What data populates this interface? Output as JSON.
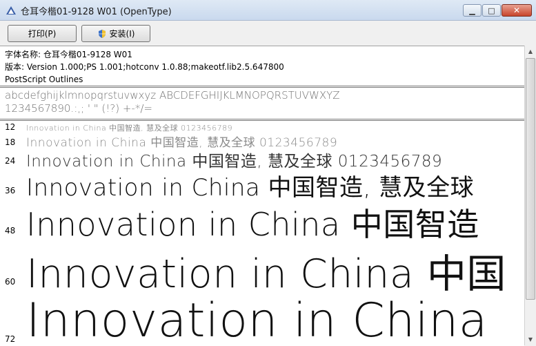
{
  "window": {
    "title": "仓耳今楷01-9128 W01 (OpenType)",
    "minimize_icon": "minimize-icon",
    "maximize_icon": "maximize-icon",
    "close_icon": "close-icon"
  },
  "toolbar": {
    "print_label": "打印(P)",
    "install_label": "安装(I)"
  },
  "info": {
    "name_line": "字体名称: 仓耳今楷01-9128 W01",
    "version_line": "版本: Version 1.000;PS 1.001;hotconv 1.0.88;makeotf.lib2.5.647800",
    "outline_line": "PostScript Outlines"
  },
  "charset": {
    "line1": "abcdefghijklmnopqrstuvwxyz ABCDEFGHIJKLMNOPQRSTUVWXYZ",
    "line2": "1234567890.:,; ' \" (!?) +-*/="
  },
  "samples": [
    {
      "size": "12",
      "text": "Innovation in China 中国智造, 慧及全球 0123456789"
    },
    {
      "size": "18",
      "text": "Innovation in China 中国智造, 慧及全球 0123456789"
    },
    {
      "size": "24",
      "text": "Innovation in China 中国智造, 慧及全球 0123456789"
    },
    {
      "size": "36",
      "text": "Innovation in China 中国智造, 慧及全球"
    },
    {
      "size": "48",
      "text": "Innovation in China 中国智造"
    },
    {
      "size": "60",
      "text": "Innovation in China 中国"
    },
    {
      "size": "72",
      "text": "Innovation in China"
    }
  ]
}
